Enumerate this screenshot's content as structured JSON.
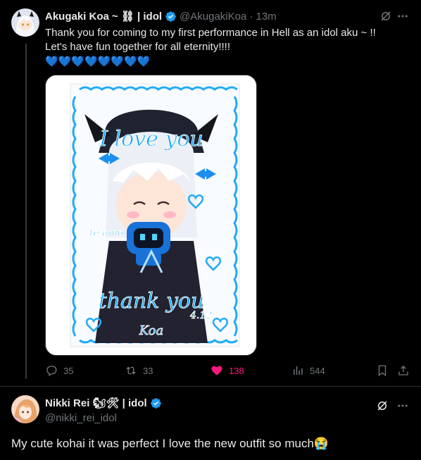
{
  "tweet1": {
    "name": "Akugaki Koa",
    "name_suffix": "~ ⛓ | idol",
    "handle": "@AkugakiKoa",
    "time": "· 13m",
    "line1": "Thank you for coming to my first performance in Hell as an idol aku ~ !!",
    "line2": "Let's have fun together for all eternity!!!!",
    "hearts": "💙💙💙💙💙💙💙💙",
    "media_caption_top": "I love you",
    "media_caption_mid": "te amo",
    "media_caption_bottom": "thank you",
    "media_date": "4.12",
    "media_sign": "Koa",
    "replies": "35",
    "reposts": "33",
    "likes": "138",
    "views": "544"
  },
  "tweet2": {
    "name": "Nikki Rei",
    "name_suffix": "🐿🛠 | idol",
    "handle": "@nikki_rei_idol",
    "text": "My cute kohai it was perfect I love the new outfit so much😭"
  },
  "colors": {
    "accent": "#1d9bf0",
    "like": "#f91880",
    "muted": "#71767b",
    "text": "#e7e9ea"
  },
  "icons": [
    "grok-icon",
    "more-icon",
    "verified-icon",
    "reply-icon",
    "repost-icon",
    "like-icon",
    "views-icon",
    "bookmark-icon",
    "share-icon"
  ]
}
